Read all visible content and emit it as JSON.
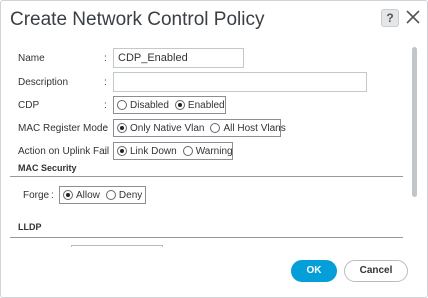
{
  "dialog": {
    "title": "Create Network Control Policy",
    "help_label": "?"
  },
  "form": {
    "name": {
      "label": "Name",
      "colon": ":",
      "value": "CDP_Enabled"
    },
    "description": {
      "label": "Description",
      "colon": ":",
      "value": ""
    },
    "cdp": {
      "label": "CDP",
      "colon": ":",
      "options": [
        "Disabled",
        "Enabled"
      ],
      "selected": "Enabled"
    },
    "mac_register_mode": {
      "label": "MAC Register Mode",
      "colon": ":",
      "options": [
        "Only Native Vlan",
        "All Host Vlans"
      ],
      "selected": "Only Native Vlan"
    },
    "action_on_uplink_fail": {
      "label": "Action on Uplink Fail",
      "colon": ":",
      "options": [
        "Link Down",
        "Warning"
      ],
      "selected": "Link Down"
    }
  },
  "mac_security": {
    "title": "MAC Security",
    "forge": {
      "label": "Forge",
      "colon": ":",
      "options": [
        "Allow",
        "Deny"
      ],
      "selected": "Allow"
    }
  },
  "lldp": {
    "title": "LLDP"
  },
  "footer": {
    "ok_label": "OK",
    "cancel_label": "Cancel"
  },
  "colors": {
    "accent": "#049fd9"
  },
  "icons": {
    "help": "question-mark-icon",
    "close": "close-icon"
  }
}
